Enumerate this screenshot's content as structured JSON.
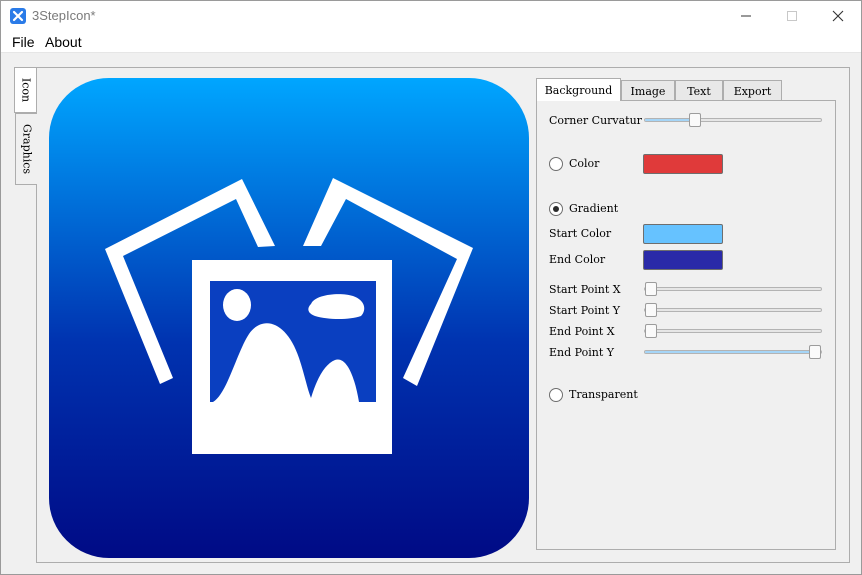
{
  "window": {
    "title": "3StepIcon*"
  },
  "menu": {
    "file": "File",
    "about": "About"
  },
  "side_tabs": {
    "icon": "Icon",
    "graphics": "Graphics"
  },
  "panel_tabs": {
    "background": "Background",
    "image": "Image",
    "text": "Text",
    "export": "Export",
    "active": "Background"
  },
  "background": {
    "corner_curvature_label": "Corner Curvatur",
    "corner_curvature_value": 0.27,
    "color_label": "Color",
    "color_value": "#e03a3a",
    "color_selected": false,
    "gradient_label": "Gradient",
    "gradient_selected": true,
    "start_color_label": "Start Color",
    "start_color_value": "#66c2ff",
    "end_color_label": "End Color",
    "end_color_value": "#2a2aa8",
    "start_point_x_label": "Start Point X",
    "start_point_x_value": 0.0,
    "start_point_y_label": "Start Point Y",
    "start_point_y_value": 0.0,
    "end_point_x_label": "End Point X",
    "end_point_x_value": 0.0,
    "end_point_y_label": "End Point Y",
    "end_point_y_value": 1.0,
    "transparent_label": "Transparent",
    "transparent_selected": false
  },
  "preview": {
    "gradient_top": "#00a6ff",
    "gradient_bottom": "#000a85",
    "image_icon": "photos-icon"
  }
}
